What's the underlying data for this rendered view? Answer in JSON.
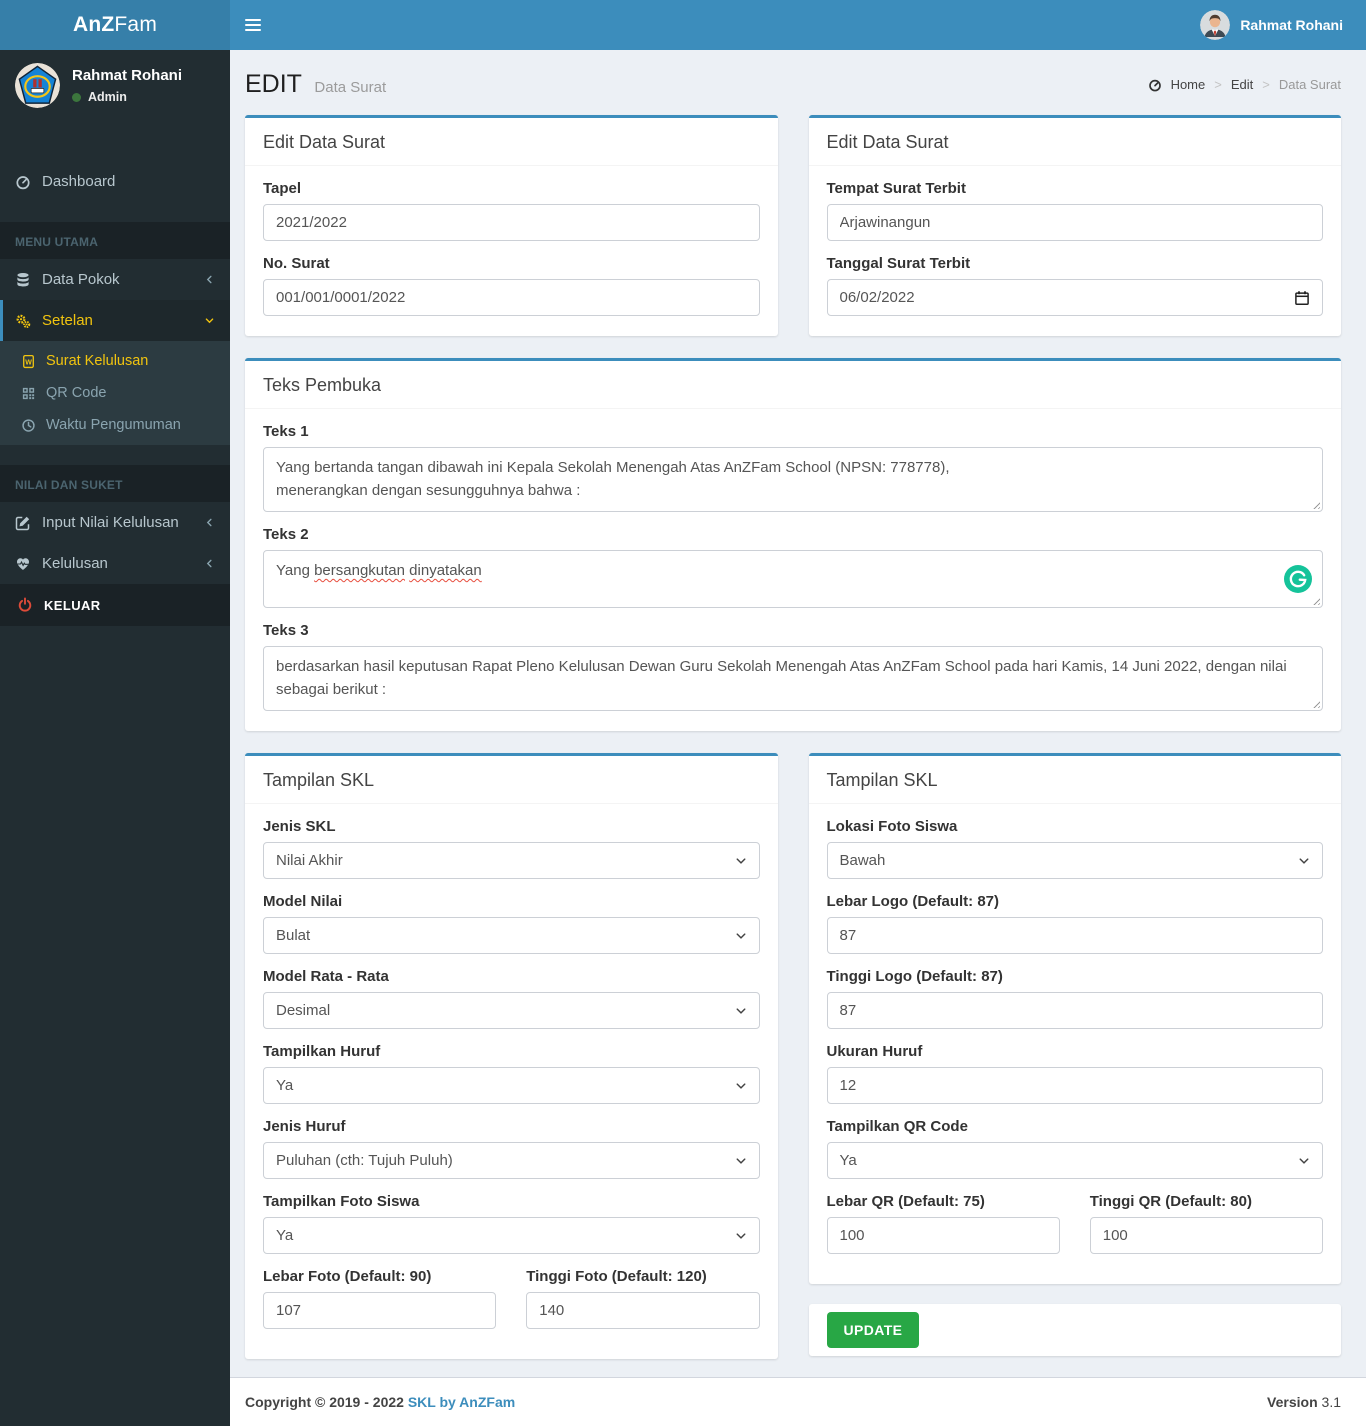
{
  "colors": {
    "navbar_blue": "#3c8dbc",
    "brand_blue": "#367fa9",
    "sidebar_dark": "#222d32",
    "accent_yellow": "#f1c40f",
    "button_green": "#28a745",
    "grammarly_green": "#15c39a",
    "logout_red": "#dd4b39"
  },
  "navbar": {
    "brand_bold": "AnZ",
    "brand_regular": "Fam",
    "user_name": "Rahmat Rohani"
  },
  "sidebar": {
    "user_name": "Rahmat Rohani",
    "user_role": "Admin",
    "dashboard": "Dashboard",
    "header_main": "MENU UTAMA",
    "data_pokok": "Data Pokok",
    "setelan": "Setelan",
    "surat_kelulusan": "Surat Kelulusan",
    "qr_code": "QR Code",
    "waktu_pengumuman": "Waktu Pengumuman",
    "header_nilai": "NILAI DAN SUKET",
    "input_nilai": "Input Nilai Kelulusan",
    "kelulusan": "Kelulusan",
    "keluar": "KELUAR"
  },
  "header": {
    "title": "EDIT",
    "subtitle": "Data Surat",
    "breadcrumb_home": "Home",
    "breadcrumb_edit": "Edit",
    "breadcrumb_current": "Data Surat"
  },
  "surat_left": {
    "title": "Edit Data Surat",
    "tapel_label": "Tapel",
    "tapel_value": "2021/2022",
    "nosurat_label": "No. Surat",
    "nosurat_value": "001/001/0001/2022"
  },
  "surat_right": {
    "title": "Edit Data Surat",
    "tempat_label": "Tempat Surat Terbit",
    "tempat_value": "Arjawinangun",
    "tanggal_label": "Tanggal Surat Terbit",
    "tanggal_value": "06/02/2022"
  },
  "teks": {
    "title": "Teks Pembuka",
    "t1_label": "Teks 1",
    "t1_line1": "Yang bertanda tangan dibawah ini Kepala Sekolah Menengah Atas AnZFam School (NPSN: 778778),",
    "t1_line2": "menerangkan dengan sesungguhnya bahwa :",
    "t2_label": "Teks 2",
    "t2_word1": "Yang",
    "t2_word2": "bersangkutan",
    "t2_word3": "dinyatakan",
    "t3_label": "Teks 3",
    "t3_value": "berdasarkan hasil keputusan Rapat Pleno Kelulusan Dewan Guru Sekolah Menengah Atas AnZFam School pada hari Kamis, 14 Juni 2022, dengan nilai sebagai berikut :"
  },
  "skl_left": {
    "title": "Tampilan SKL",
    "jenis_label": "Jenis SKL",
    "jenis_value": "Nilai Akhir",
    "model_nilai_label": "Model Nilai",
    "model_nilai_value": "Bulat",
    "model_rata_label": "Model Rata - Rata",
    "model_rata_value": "Desimal",
    "tampilkan_huruf_label": "Tampilkan Huruf",
    "tampilkan_huruf_value": "Ya",
    "jenis_huruf_label": "Jenis Huruf",
    "jenis_huruf_value": "Puluhan (cth: Tujuh Puluh)",
    "tampilkan_foto_label": "Tampilkan Foto Siswa",
    "tampilkan_foto_value": "Ya",
    "lebar_foto_label": "Lebar Foto (Default: 90)",
    "lebar_foto_value": "107",
    "tinggi_foto_label": "Tinggi Foto (Default: 120)",
    "tinggi_foto_value": "140"
  },
  "skl_right": {
    "title": "Tampilan SKL",
    "lokasi_label": "Lokasi Foto Siswa",
    "lokasi_value": "Bawah",
    "lebar_logo_label": "Lebar Logo (Default: 87)",
    "lebar_logo_value": "87",
    "tinggi_logo_label": "Tinggi Logo (Default: 87)",
    "tinggi_logo_value": "87",
    "ukuran_label": "Ukuran Huruf",
    "ukuran_value": "12",
    "qr_label": "Tampilkan QR Code",
    "qr_value": "Ya",
    "lebar_qr_label": "Lebar QR (Default: 75)",
    "lebar_qr_value": "100",
    "tinggi_qr_label": "Tinggi QR (Default: 80)",
    "tinggi_qr_value": "100"
  },
  "update_button": "UPDATE",
  "footer": {
    "copyright": "Copyright © 2019 - 2022",
    "link": "SKL by AnZFam",
    "version_label": "Version",
    "version_value": "3.1"
  }
}
